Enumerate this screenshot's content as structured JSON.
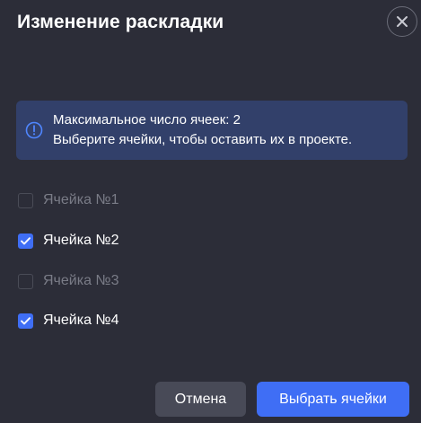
{
  "dialog": {
    "title": "Изменение раскладки",
    "close_icon": "close-icon"
  },
  "info": {
    "icon": "info-circle-icon",
    "line1": "Максимальное число ячеек: 2",
    "line2": "Выберите ячейки, чтобы оставить их в проекте."
  },
  "options": [
    {
      "label": "Ячейка №1",
      "checked": false,
      "disabled": true
    },
    {
      "label": "Ячейка №2",
      "checked": true,
      "disabled": false
    },
    {
      "label": "Ячейка №3",
      "checked": false,
      "disabled": true
    },
    {
      "label": "Ячейка №4",
      "checked": true,
      "disabled": false
    }
  ],
  "buttons": {
    "cancel_label": "Отмена",
    "confirm_label": "Выбрать ячейки"
  },
  "colors": {
    "accent": "#3f6ef5",
    "background": "#2c2d38",
    "info_background": "#32406a"
  }
}
